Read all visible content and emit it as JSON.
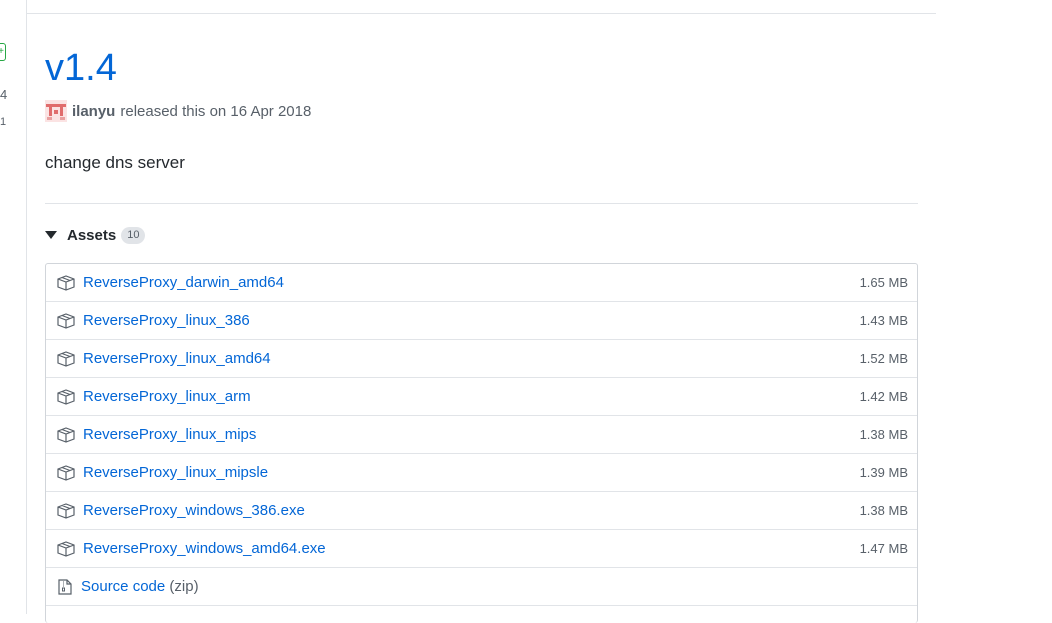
{
  "sidebar": {
    "tag_text": "+",
    "num1": "4",
    "num2": "1"
  },
  "release": {
    "title": "v1.4",
    "author": "ilanyu",
    "released_text": "released this on 16 Apr 2018",
    "description": "change dns server"
  },
  "assets": {
    "label": "Assets",
    "count": "10",
    "items": [
      {
        "name": "ReverseProxy_darwin_amd64",
        "size": "1.65 MB"
      },
      {
        "name": "ReverseProxy_linux_386",
        "size": "1.43 MB"
      },
      {
        "name": "ReverseProxy_linux_amd64",
        "size": "1.52 MB"
      },
      {
        "name": "ReverseProxy_linux_arm",
        "size": "1.42 MB"
      },
      {
        "name": "ReverseProxy_linux_mips",
        "size": "1.38 MB"
      },
      {
        "name": "ReverseProxy_linux_mipsle",
        "size": "1.39 MB"
      },
      {
        "name": "ReverseProxy_windows_386.exe",
        "size": "1.38 MB"
      },
      {
        "name": "ReverseProxy_windows_amd64.exe",
        "size": "1.47 MB"
      }
    ],
    "source": {
      "label": "Source code",
      "format": "(zip)"
    }
  },
  "colors": {
    "link": "#0366d6",
    "muted": "#586069",
    "border": "#e1e4e8",
    "green": "#28a745"
  },
  "icons": {
    "asset": "package-icon",
    "source": "file-zip-icon",
    "caret": "triangle-down-icon"
  }
}
